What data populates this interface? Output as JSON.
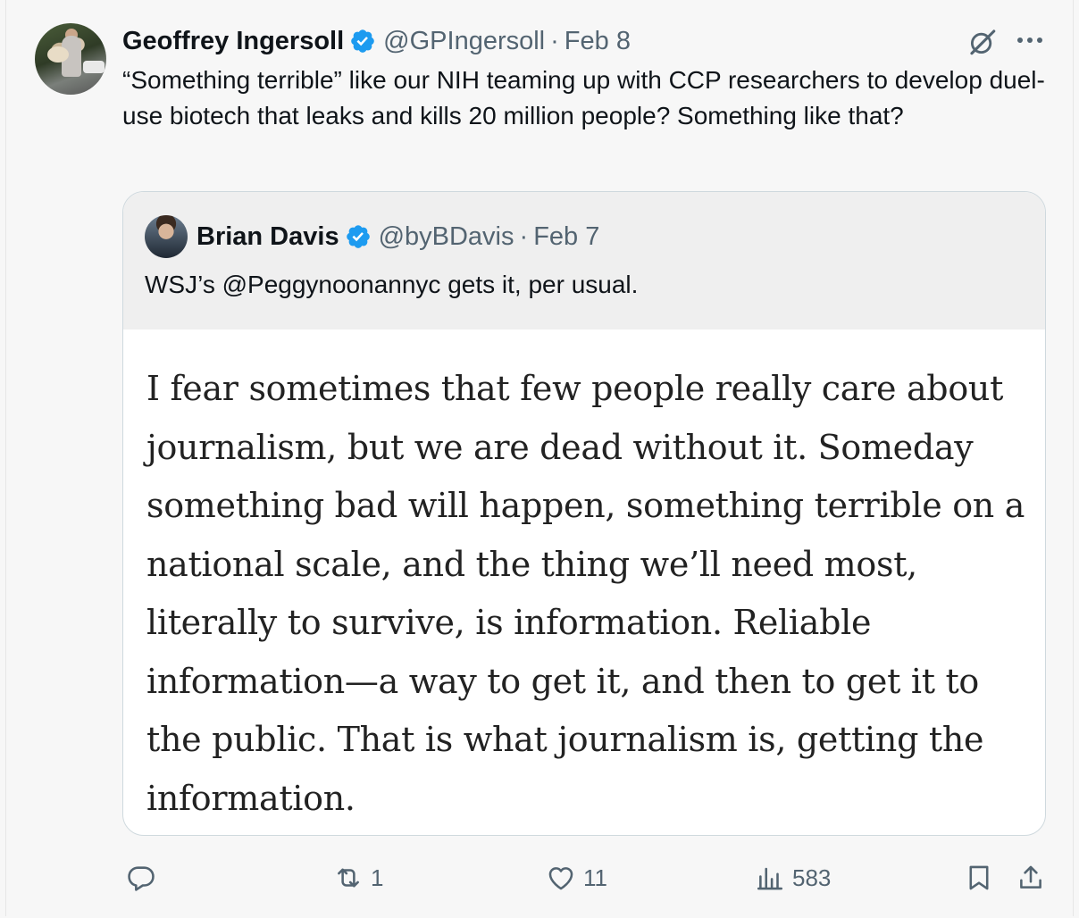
{
  "tweet": {
    "author_name": "Geoffrey Ingersoll",
    "author_handle": "@GPIngersoll",
    "separator": "·",
    "date": "Feb 8",
    "text": "“Something terrible” like our NIH teaming up with CCP researchers to develop duel-use biotech that leaks and kills 20 million people? Something like that?"
  },
  "quoted": {
    "author_name": "Brian Davis",
    "author_handle": "@byBDavis",
    "separator": "·",
    "date": "Feb 7",
    "text": "WSJ’s @Peggynoonannyc gets it, per usual.",
    "image_text": "I fear sometimes that few people really care about journalism, but we are dead without it. Someday something bad will happen, something terrible on a national scale, and the thing we’ll need most, literally to survive, is information. Reliable information—a way to get it, and then to get it to the public. That is what journalism is, getting the information."
  },
  "actions": {
    "replies": "",
    "reposts": "1",
    "likes": "11",
    "views": "583"
  },
  "icons": {
    "verified": "verified-badge-icon",
    "grok": "grok-icon",
    "more": "more-icon",
    "reply": "reply-icon",
    "repost": "repost-icon",
    "like": "heart-icon",
    "views": "views-icon",
    "bookmark": "bookmark-icon",
    "share": "share-icon"
  },
  "colors": {
    "verified": "#1d9bf0",
    "secondary_text": "#536471",
    "border": "#cfd9de"
  }
}
